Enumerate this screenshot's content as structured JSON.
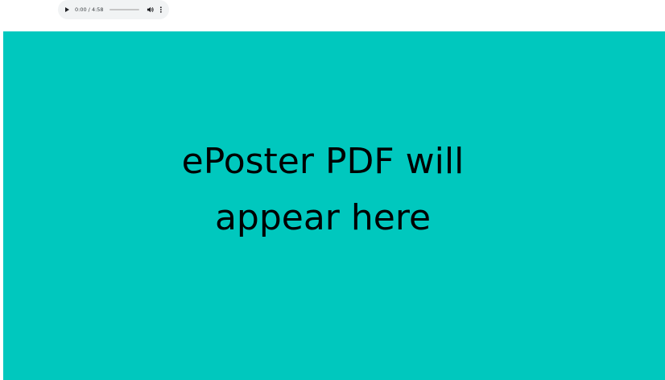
{
  "audio_player": {
    "play_icon": "play-icon",
    "time_current": "0:00",
    "time_separator": " / ",
    "time_total": "4:58",
    "progress": 0,
    "volume_icon": "volume-icon",
    "menu_icon": "more-vertical-icon"
  },
  "poster": {
    "background_color": "#00c8be",
    "placeholder_line1": "ePoster PDF will",
    "placeholder_line2": "appear here"
  }
}
